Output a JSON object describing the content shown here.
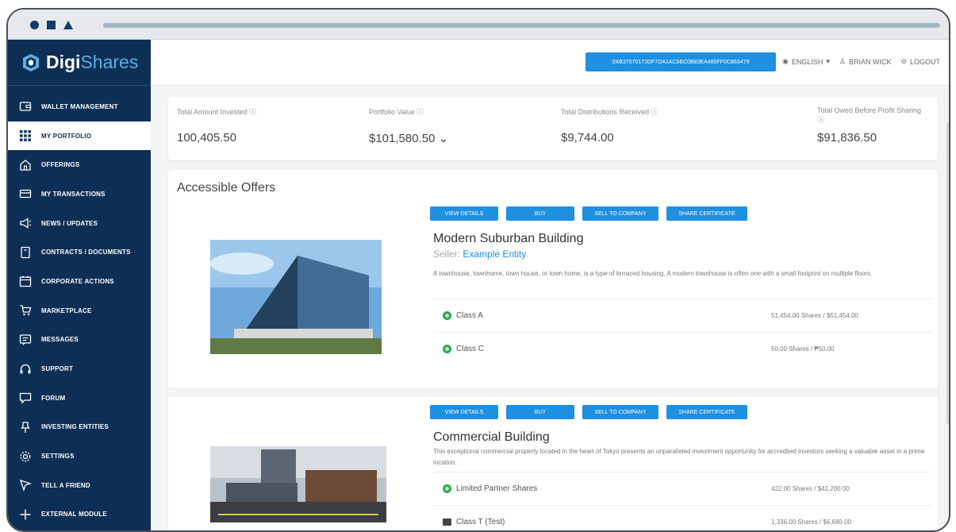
{
  "app": {
    "brand_part1": "Digi",
    "brand_part2": "Shares"
  },
  "sidebar": {
    "items": [
      {
        "label": "WALLET MANAGEMENT",
        "icon": "wallet-icon"
      },
      {
        "label": "MY PORTFOLIO",
        "icon": "grid-icon",
        "active": true
      },
      {
        "label": "OFFERINGS",
        "icon": "home-icon"
      },
      {
        "label": "MY TRANSACTIONS",
        "icon": "card-icon"
      },
      {
        "label": "NEWS / UPDATES",
        "icon": "megaphone-icon"
      },
      {
        "label": "CONTRACTS / DOCUMENTS",
        "icon": "document-icon"
      },
      {
        "label": "CORPORATE ACTIONS",
        "icon": "calendar-icon"
      },
      {
        "label": "MARKETPLACE",
        "icon": "cart-icon"
      },
      {
        "label": "MESSAGES",
        "icon": "message-icon"
      },
      {
        "label": "SUPPORT",
        "icon": "headset-icon"
      },
      {
        "label": "FORUM",
        "icon": "chat-icon"
      },
      {
        "label": "INVESTING ENTITIES",
        "icon": "pin-icon"
      },
      {
        "label": "SETTINGS",
        "icon": "gear-icon"
      },
      {
        "label": "TELL A FRIEND",
        "icon": "send-icon"
      },
      {
        "label": "EXTERNAL MODULE",
        "icon": "plus-icon"
      }
    ]
  },
  "header": {
    "wallet_address": "0XB37070173DF7DA1AC6BC0B83EA485FF0C863479",
    "language": "ENGLISH",
    "user": "BRIAN WICK",
    "logout": "LOGOUT"
  },
  "stats": {
    "invested_label": "Total Amount Invested",
    "invested_value": "100,405.50",
    "portfolio_label": "Portfolio Value",
    "portfolio_value": "$101,580.50",
    "distributions_label": "Total Distributions Received",
    "distributions_value": "$9,744.00",
    "owed_label": "Total Owed Before Profit Sharing",
    "owed_value": "$91,836.50"
  },
  "offers": {
    "title": "Accessible Offers",
    "buttons": {
      "view": "VIEW DETAILS",
      "buy": "BUY",
      "sell": "SELL TO COMPANY",
      "cert": "SHARE CERTIFICATE"
    },
    "items": [
      {
        "name": "Modern Suburban Building",
        "seller_label": "Seller:",
        "seller": "Example Entity",
        "description": "A townhouse, townhome, town house, or town home, is a type of terraced housing. A modern townhouse is often one with a small footprint on multiple floors.",
        "classes": [
          {
            "name": "Class A",
            "shares": "51,454.00 Shares / $51,454.00"
          },
          {
            "name": "Class C",
            "shares": "50.00 Shares / ₱50.00"
          }
        ]
      },
      {
        "name": "Commercial Building",
        "description": "This exceptional commercial property located in the heart of Tokyo presents an unparalleled investment opportunity for accredited investors seeking a valuable asset in a prime location.",
        "classes": [
          {
            "name": "Limited Partner Shares",
            "shares": "422.00 Shares / $42,200.00"
          },
          {
            "name": "Class T (Test)",
            "shares": "1,336.00 Shares / $6,680.00"
          }
        ]
      }
    ]
  },
  "colors": {
    "sidebar": "#0e2f55",
    "accent": "#1f8fe0",
    "brand_light": "#5ab1e6"
  }
}
